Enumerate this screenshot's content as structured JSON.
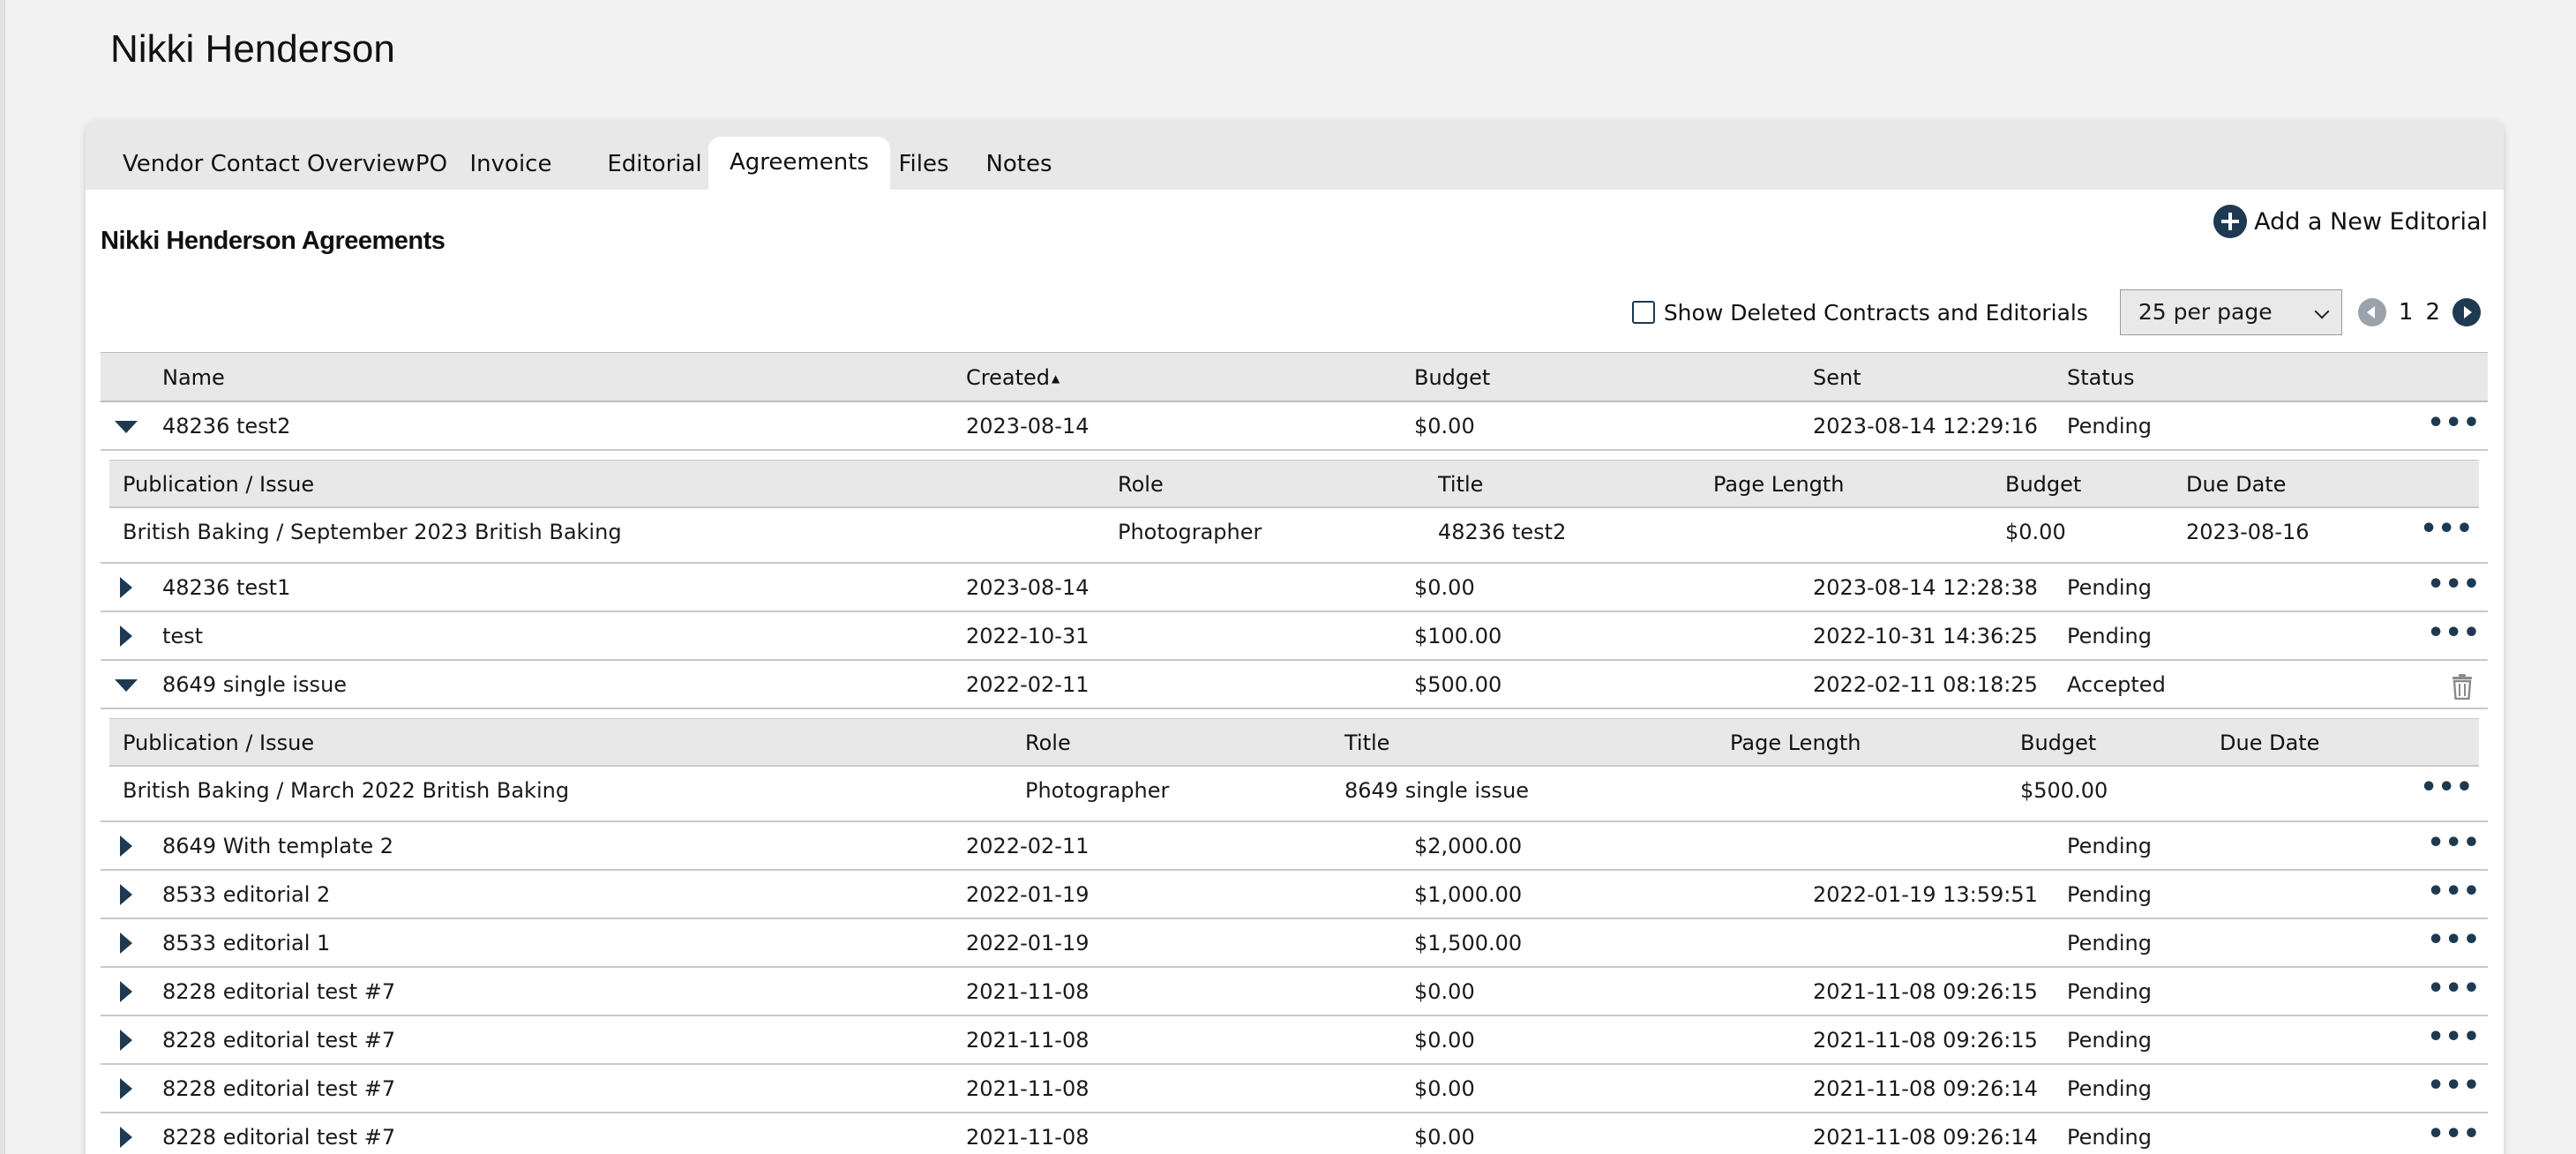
{
  "page": {
    "title": "Nikki Henderson"
  },
  "tabs": [
    {
      "label": "Vendor Contact Overview"
    },
    {
      "label": "PO"
    },
    {
      "label": "Invoice"
    },
    {
      "label": "Editorial"
    },
    {
      "label": "Agreements",
      "active": true
    },
    {
      "label": "Files"
    },
    {
      "label": "Notes"
    }
  ],
  "section": {
    "title": "Nikki Henderson Agreements",
    "add_label": "Add a New Editorial"
  },
  "controls": {
    "show_deleted_label": "Show Deleted Contracts and Editorials",
    "per_page": "25 per page",
    "pages": [
      "1",
      "2"
    ]
  },
  "table": {
    "columns": {
      "name": "Name",
      "created": "Created",
      "budget": "Budget",
      "sent": "Sent",
      "status": "Status"
    },
    "rows": [
      {
        "name": "48236 test2",
        "created": "2023-08-14",
        "budget": "$0.00",
        "sent": "2023-08-14 12:29:16",
        "status": "Pending"
      },
      {
        "name": "48236 test1",
        "created": "2023-08-14",
        "budget": "$0.00",
        "sent": "2023-08-14 12:28:38",
        "status": "Pending"
      },
      {
        "name": "test",
        "created": "2022-10-31",
        "budget": "$100.00",
        "sent": "2022-10-31 14:36:25",
        "status": "Pending"
      },
      {
        "name": "8649 single issue",
        "created": "2022-02-11",
        "budget": "$500.00",
        "sent": "2022-02-11 08:18:25",
        "status": "Accepted"
      },
      {
        "name": "8649 With template 2",
        "created": "2022-02-11",
        "budget": "$2,000.00",
        "sent": "",
        "status": "Pending"
      },
      {
        "name": "8533 editorial 2",
        "created": "2022-01-19",
        "budget": "$1,000.00",
        "sent": "2022-01-19 13:59:51",
        "status": "Pending"
      },
      {
        "name": "8533 editorial 1",
        "created": "2022-01-19",
        "budget": "$1,500.00",
        "sent": "",
        "status": "Pending"
      },
      {
        "name": "8228 editorial test #7",
        "created": "2021-11-08",
        "budget": "$0.00",
        "sent": "2021-11-08 09:26:15",
        "status": "Pending"
      },
      {
        "name": "8228 editorial test #7",
        "created": "2021-11-08",
        "budget": "$0.00",
        "sent": "2021-11-08 09:26:15",
        "status": "Pending"
      },
      {
        "name": "8228 editorial test #7",
        "created": "2021-11-08",
        "budget": "$0.00",
        "sent": "2021-11-08 09:26:14",
        "status": "Pending"
      },
      {
        "name": "8228 editorial test #7",
        "created": "2021-11-08",
        "budget": "$0.00",
        "sent": "2021-11-08 09:26:14",
        "status": "Pending"
      }
    ],
    "sub_columns": {
      "publication": "Publication / Issue",
      "role": "Role",
      "title": "Title",
      "page_length": "Page Length",
      "budget": "Budget",
      "due_date": "Due Date"
    },
    "details": [
      {
        "publication": "British Baking / September 2023 British Baking",
        "role": "Photographer",
        "title": "48236 test2",
        "page_length": "",
        "budget": "$0.00",
        "due_date": "2023-08-16"
      },
      {
        "publication": "British Baking / March 2022 British Baking",
        "role": "Photographer",
        "title": "8649 single issue",
        "page_length": "",
        "budget": "$500.00",
        "due_date": ""
      }
    ]
  }
}
